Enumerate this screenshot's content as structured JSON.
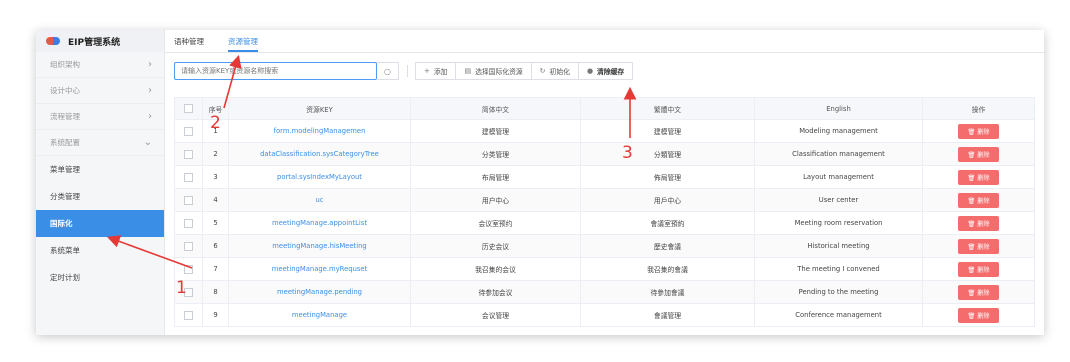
{
  "app_title": "EIP管理系统",
  "sidebar": {
    "groups": [
      {
        "label": "组织架构"
      },
      {
        "label": "设计中心"
      },
      {
        "label": "流程管理"
      },
      {
        "label": "系统配置"
      }
    ],
    "sub_items": [
      {
        "label": "菜单管理"
      },
      {
        "label": "分类管理"
      },
      {
        "label": "国际化",
        "active": true
      },
      {
        "label": "系统菜单"
      },
      {
        "label": "定时计划"
      }
    ]
  },
  "tabs": [
    {
      "label": "语种管理"
    },
    {
      "label": "资源管理",
      "active": true
    }
  ],
  "toolbar": {
    "search_placeholder": "请输入资源KEY或资源名称搜索",
    "add_label": "添加",
    "select_label": "选择国际化资源",
    "init_label": "初始化",
    "clear_cache_label": "清除缓存"
  },
  "table": {
    "headers": [
      "序号",
      "资源KEY",
      "简体中文",
      "繁體中文",
      "English",
      "操作"
    ],
    "rows": [
      {
        "no": "1",
        "key": "form.modelingManagemen",
        "zh": "建模管理",
        "tw": "建模管理",
        "en": "Modeling management"
      },
      {
        "no": "2",
        "key": "dataClassification.sysCategoryTree",
        "zh": "分类管理",
        "tw": "分類管理",
        "en": "Classification management"
      },
      {
        "no": "3",
        "key": "portal.sysIndexMyLayout",
        "zh": "布局管理",
        "tw": "佈局管理",
        "en": "Layout management"
      },
      {
        "no": "4",
        "key": "uc",
        "zh": "用户中心",
        "tw": "用戶中心",
        "en": "User center"
      },
      {
        "no": "5",
        "key": "meetingManage.appointList",
        "zh": "会议室预约",
        "tw": "會議室預約",
        "en": "Meeting room reservation"
      },
      {
        "no": "6",
        "key": "meetingManage.hisMeeting",
        "zh": "历史会议",
        "tw": "歷史會議",
        "en": "Historical meeting"
      },
      {
        "no": "7",
        "key": "meetingManage.myRequset",
        "zh": "我召集的会议",
        "tw": "我召集的會議",
        "en": "The meeting I convened"
      },
      {
        "no": "8",
        "key": "meetingManage.pending",
        "zh": "待参加会议",
        "tw": "待參加會議",
        "en": "Pending to the meeting"
      },
      {
        "no": "9",
        "key": "meetingManage",
        "zh": "会议管理",
        "tw": "會議管理",
        "en": "Conference management"
      }
    ],
    "delete_label": "删除"
  },
  "annotations": [
    "1",
    "2",
    "3"
  ],
  "colors": {
    "accent": "#3a8ee6",
    "danger": "#f56c6c",
    "annotation": "#e53935"
  }
}
